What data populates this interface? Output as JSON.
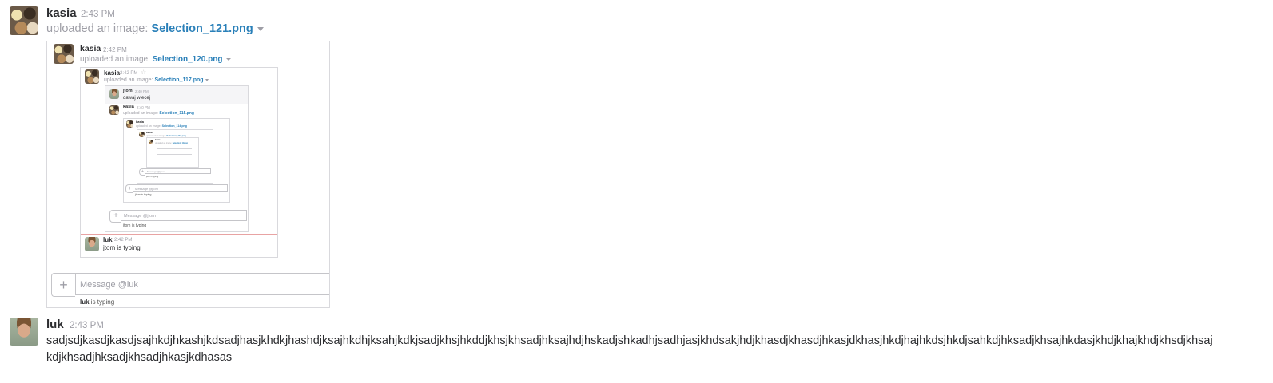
{
  "messages": [
    {
      "author": "kasia",
      "time": "2:43 PM",
      "upload_prefix": "uploaded an image:",
      "filename": "Selection_121.png"
    },
    {
      "author": "luk",
      "time": "2:43 PM",
      "text_line1": "sadjsdjkasdjkasdjsajhkdjhkashjkdsadjhasjkhdkjhashdjksajhkdhjksahjkdkjsadjkhsjhkddjkhsjkhsadjhksajhdjhskadjshkadhjsadhjasjkhdsakjhdjkhasdjkhasdjhkasjdkhasjhkdjhajhkdsjhkdjsahkdjhksadjkhsajhkdasjkhdjkhajkhdjkhsdjkhsaj",
      "text_line2": "kdjkhsadjhksadjkhsadjhkasjkdhasas"
    }
  ],
  "screenshot_l1": {
    "author": "kasia",
    "time": "2:42 PM",
    "upload_prefix": "uploaded an image:",
    "filename": "Selection_120.png",
    "composer_placeholder": "Message @luk",
    "typing_user": "luk",
    "typing_suffix": "is typing"
  },
  "screenshot_l2": {
    "author": "kasia",
    "time": "2:42 PM",
    "upload_prefix": "uploaded an image:",
    "filename": "Selection_117.png",
    "reply_author": "luk",
    "reply_time": "2:42 PM",
    "reply_text": "jtom is typing"
  },
  "screenshot_l3": {
    "msg1_author": "jtom",
    "msg1_time": "2:40 PM",
    "msg1_text": "dawaj wiecej",
    "msg2_author": "kasia",
    "msg2_time": "2:40 PM",
    "upload_prefix": "uploaded an image:",
    "filename": "Selection_115.png",
    "composer_placeholder": "Message @jtom",
    "typing_text": "jtom is typing"
  },
  "screenshot_l4": {
    "author": "kasia",
    "upload_prefix": "uploaded an image:",
    "filename": "Selection_114.png",
    "composer_placeholder": "Message @jtom",
    "typing_text": "jtom is typing"
  },
  "screenshot_l5": {
    "author": "kasia",
    "upload_prefix": "uploaded an image:",
    "filename": "Selection_113.png",
    "composer_placeholder": "Message @jtom",
    "typing_text": "jtom is typing"
  },
  "screenshot_l6": {
    "author": "kasia",
    "upload_prefix": "uploaded an image:",
    "filename": "Selection_112.pn"
  },
  "icons": {
    "caret": "chevron-down-icon",
    "plus": "plus-icon",
    "star": "star-icon"
  },
  "colors": {
    "link": "#2a80b9",
    "muted": "#9e9ea6",
    "text": "#2c2d30",
    "border": "#d9d9dd"
  }
}
